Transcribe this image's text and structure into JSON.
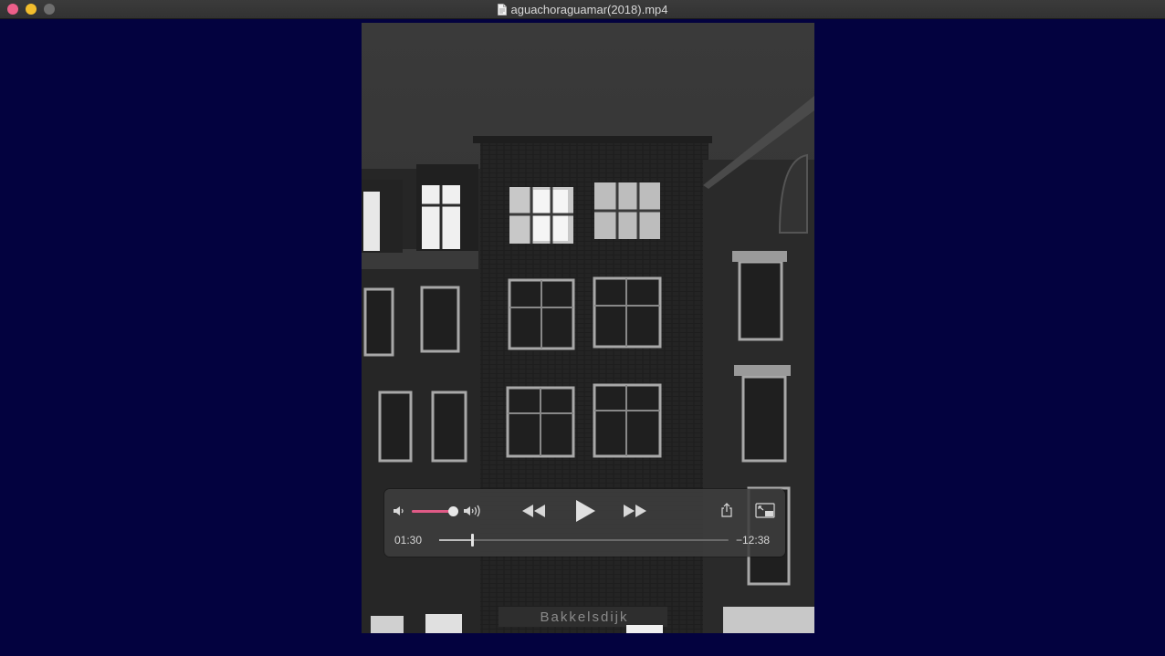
{
  "window": {
    "title": "aguachoraguamar(2018).mp4",
    "icons": [
      "close-button",
      "minimize-button",
      "zoom-button",
      "document-icon"
    ]
  },
  "player": {
    "background_color": "#03023f",
    "video_description": "Black and white night view of a brick apartment building with lit windows",
    "storefront_text": "Bakkelsdijk",
    "volume_level": 1.0,
    "progress_fraction": 0.113,
    "elapsed": "01:30",
    "remaining": "−12:38",
    "accent_color": "#e05a86",
    "icons": [
      "volume-low-icon",
      "volume-high-icon",
      "rewind-icon",
      "play-icon",
      "fast-forward-icon",
      "share-icon",
      "picture-in-picture-icon"
    ]
  }
}
